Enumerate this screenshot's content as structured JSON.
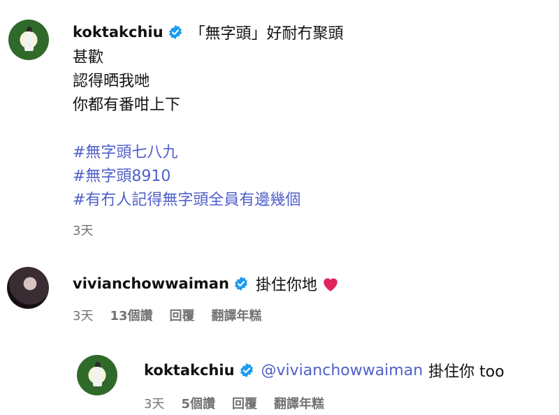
{
  "comments": [
    {
      "username": "koktakchiu",
      "first_line": "「無字頭」好耐冇聚頭",
      "lines": [
        "甚歡",
        "認得晒我哋",
        "你都有番咁上下"
      ],
      "hashtags": [
        "#無字頭七八九",
        "#無字頭8910",
        "#有冇人記得無字頭全員有邊幾個"
      ],
      "time": "3天"
    },
    {
      "username": "vivianchowwaiman",
      "text": "掛住你地",
      "time": "3天",
      "likes": "13個讚",
      "reply": "回覆",
      "translate": "翻譯年糕",
      "reaction_icon": "heart-icon"
    },
    {
      "username": "koktakchiu",
      "mention": "@vivianchowwaiman",
      "text": "掛住你 too",
      "time": "3天",
      "likes": "5個讚",
      "reply": "回覆",
      "translate": "翻譯年糕"
    }
  ],
  "colors": {
    "hashtag": "#4f5fc9",
    "verified": "#1d9bf0",
    "meta": "#737373",
    "heart": "#e0245e"
  }
}
